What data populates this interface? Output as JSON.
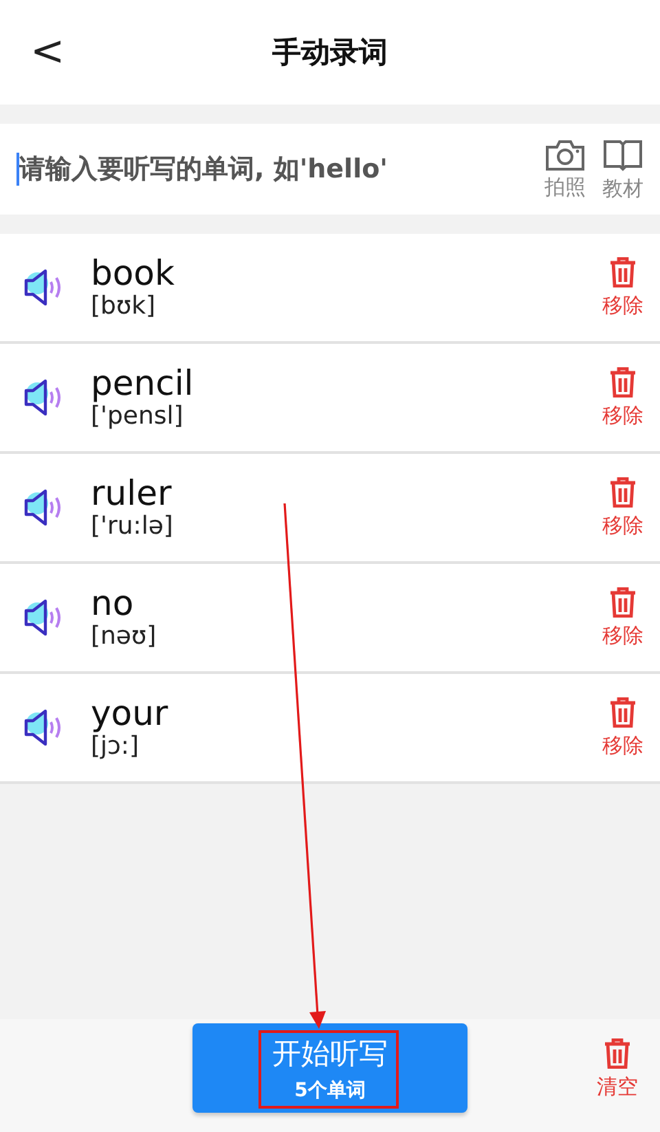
{
  "header": {
    "back": "<",
    "title": "手动录词"
  },
  "input": {
    "placeholder": "请输入要听写的单词, 如'hello'",
    "actions": [
      {
        "kind": "camera",
        "label": "拍照"
      },
      {
        "kind": "book",
        "label": "教材"
      }
    ]
  },
  "words": [
    {
      "word": "book",
      "phonetic": "[bʊk]",
      "remove": "移除"
    },
    {
      "word": "pencil",
      "phonetic": "['pensl]",
      "remove": "移除"
    },
    {
      "word": "ruler",
      "phonetic": "['ru:lə]",
      "remove": "移除"
    },
    {
      "word": "no",
      "phonetic": "[nəʊ]",
      "remove": "移除"
    },
    {
      "word": "your",
      "phonetic": "[jɔ:]",
      "remove": "移除"
    }
  ],
  "footer": {
    "start_button": {
      "title": "开始听写",
      "subtitle": "5个单词"
    },
    "clear": "清空"
  }
}
